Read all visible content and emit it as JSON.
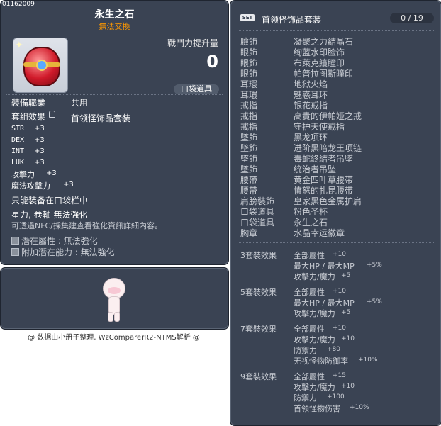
{
  "item": {
    "id_label": "01162009",
    "name": "永生之石",
    "tradability": "無法交換",
    "power_label": "戰鬥力提升量",
    "power_value": "0",
    "pocket_badge": "口袋道具",
    "job_label": "裝備職業",
    "job_value": "共用",
    "set_label": "套組效果",
    "set_value": "首领怪饰品套装",
    "stats": [
      {
        "name": "STR",
        "value": "+3"
      },
      {
        "name": "DEX",
        "value": "+3"
      },
      {
        "name": "INT",
        "value": "+3"
      },
      {
        "name": "LUK",
        "value": "+3"
      }
    ],
    "attack": {
      "name": "攻擊力",
      "value": "+3"
    },
    "magic": {
      "name": "魔法攻擊力",
      "value": "+3"
    },
    "pocket_only": "只能装备在口袋栏中",
    "enhance_note": "星力, 卷軸 無法強化",
    "npc_note": "可透過NFC/採集建查看強化資訊詳細內容。",
    "potential": "潛在屬性 : 無法強化",
    "additional_potential": "附加潛在能力 : 無法強化"
  },
  "credit": "@ 数据由小册子整理, WzComparerR2-NTMS解析 @",
  "set_panel": {
    "badge": "SET",
    "title": "首领怪饰品套装",
    "count": "0 / 19",
    "pieces": [
      {
        "slot": "臉飾",
        "name": "凝聚之力結晶石"
      },
      {
        "slot": "眼飾",
        "name": "绚蓝水印脸饰"
      },
      {
        "slot": "眼飾",
        "name": "布萊克繽瞳印"
      },
      {
        "slot": "眼飾",
        "name": "帕普拉图斯瞳印"
      },
      {
        "slot": "耳環",
        "name": "地狱火焰"
      },
      {
        "slot": "耳環",
        "name": "魅惑耳环"
      },
      {
        "slot": "戒指",
        "name": "银花戒指"
      },
      {
        "slot": "戒指",
        "name": "高貴的伊帕娅之戒"
      },
      {
        "slot": "戒指",
        "name": "守护天使戒指"
      },
      {
        "slot": "墜飾",
        "name": "黑龙项环"
      },
      {
        "slot": "墜飾",
        "name": "进阶黑暗龙王项链"
      },
      {
        "slot": "墜飾",
        "name": "毒蛇終結者吊墜"
      },
      {
        "slot": "墜飾",
        "name": "统治者吊坠"
      },
      {
        "slot": "腰帶",
        "name": "黄金四叶草腰带"
      },
      {
        "slot": "腰帶",
        "name": "憤怒的扎昆腰带"
      },
      {
        "slot": "肩膀裝飾",
        "name": "皇家黑色金属护肩"
      },
      {
        "slot": "口袋道具",
        "name": "粉色圣杯"
      },
      {
        "slot": "口袋道具",
        "name": "永生之石"
      },
      {
        "slot": "胸章",
        "name": "水晶幸运徽章"
      }
    ],
    "effects": [
      {
        "header": "3套裝效果",
        "lines": [
          {
            "name": "全部屬性",
            "value": "+10"
          },
          {
            "name": "最大HP / 最大MP",
            "value": "+5%"
          },
          {
            "name": "攻擊力/魔力",
            "value": "+5"
          }
        ]
      },
      {
        "header": "5套裝效果",
        "lines": [
          {
            "name": "全部屬性",
            "value": "+10"
          },
          {
            "name": "最大HP / 最大MP",
            "value": "+5%"
          },
          {
            "name": "攻擊力/魔力",
            "value": "+5"
          }
        ]
      },
      {
        "header": "7套裝效果",
        "lines": [
          {
            "name": "全部屬性",
            "value": "+10"
          },
          {
            "name": "攻擊力/魔力",
            "value": "+10"
          },
          {
            "name": "防禦力",
            "value": "+80"
          },
          {
            "name": "无视怪物防御率",
            "value": "+10%"
          }
        ]
      },
      {
        "header": "9套裝效果",
        "lines": [
          {
            "name": "全部屬性",
            "value": "+15"
          },
          {
            "name": "攻擊力/魔力",
            "value": "+10"
          },
          {
            "name": "防禦力",
            "value": "+100"
          },
          {
            "name": "首领怪物伤害",
            "value": "+10%"
          }
        ]
      }
    ]
  }
}
